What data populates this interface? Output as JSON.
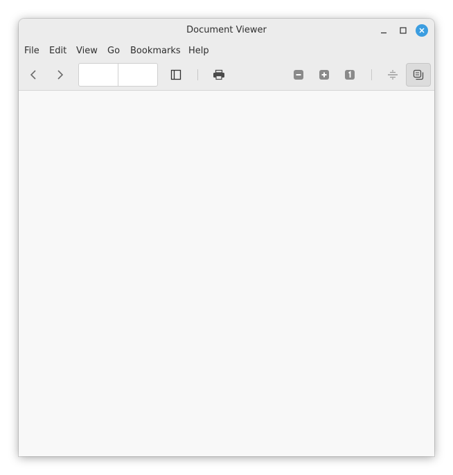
{
  "window": {
    "title": "Document Viewer"
  },
  "menubar": {
    "items": [
      "File",
      "Edit",
      "View",
      "Go",
      "Bookmarks",
      "Help"
    ]
  },
  "toolbar": {
    "page_number_value": "",
    "page_count_value": ""
  },
  "icons": {
    "back": "chevron-left-icon",
    "forward": "chevron-right-icon",
    "sidebar": "sidebar-icon",
    "print": "printer-icon",
    "zoom_out": "zoom-out-icon",
    "zoom_in": "zoom-in-icon",
    "zoom_reset": "zoom-original-icon",
    "fit_page": "fit-page-icon",
    "continuous": "continuous-pages-icon"
  },
  "colors": {
    "close_button": "#3b9de0",
    "titlebar": "#ececec",
    "content": "#f8f8f8"
  }
}
